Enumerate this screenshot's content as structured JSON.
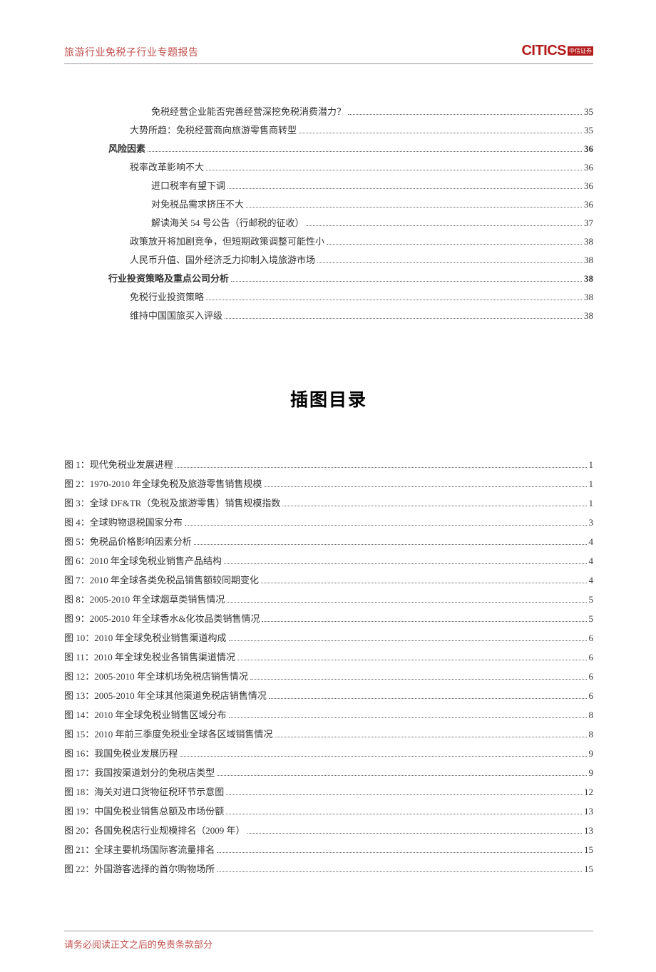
{
  "header": {
    "title": "旅游行业免税子行业专题报告",
    "logo_text": "CITICS",
    "logo_badge": "中信证券"
  },
  "toc": [
    {
      "level": 3,
      "label": "免税经营企业能否完善经营深挖免税消费潜力？",
      "page": "35",
      "bold": false
    },
    {
      "level": 2,
      "label": "大势所趋：免税经营商向旅游零售商转型",
      "page": "35",
      "bold": false
    },
    {
      "level": 1,
      "label": "风险因素",
      "page": "36",
      "bold": true
    },
    {
      "level": 2,
      "label": "税率改革影响不大",
      "page": "36",
      "bold": false
    },
    {
      "level": 3,
      "label": "进口税率有望下调",
      "page": "36",
      "bold": false
    },
    {
      "level": 3,
      "label": "对免税品需求挤压不大",
      "page": "36",
      "bold": false
    },
    {
      "level": 3,
      "label": "解读海关 54 号公告（行邮税的征收）",
      "page": "37",
      "bold": false
    },
    {
      "level": 2,
      "label": "政策放开将加剧竞争，但短期政策调整可能性小",
      "page": "38",
      "bold": false
    },
    {
      "level": 2,
      "label": "人民币升值、国外经济乏力抑制入境旅游市场",
      "page": "38",
      "bold": false
    },
    {
      "level": 1,
      "label": "行业投资策略及重点公司分析",
      "page": "38",
      "bold": true
    },
    {
      "level": 2,
      "label": "免税行业投资策略",
      "page": "38",
      "bold": false
    },
    {
      "level": 2,
      "label": "维持中国国旅买入评级",
      "page": "38",
      "bold": false
    }
  ],
  "figures_title": "插图目录",
  "figures": [
    {
      "label": "图 1：现代免税业发展进程",
      "page": "1"
    },
    {
      "label": "图 2：1970-2010 年全球免税及旅游零售销售规模",
      "page": "1"
    },
    {
      "label": "图 3：全球 DF&TR（免税及旅游零售）销售规模指数",
      "page": "1"
    },
    {
      "label": "图 4：全球购物退税国家分布",
      "page": "3"
    },
    {
      "label": "图 5：免税品价格影响因素分析",
      "page": "4"
    },
    {
      "label": "图 6：2010 年全球免税业销售产品结构",
      "page": "4"
    },
    {
      "label": "图 7：2010 年全球各类免税品销售额较同期变化",
      "page": "4"
    },
    {
      "label": "图 8：2005-2010 年全球烟草类销售情况",
      "page": "5"
    },
    {
      "label": "图 9：2005-2010 年全球香水&化妆品类销售情况",
      "page": "5"
    },
    {
      "label": "图 10：2010 年全球免税业销售渠道构成",
      "page": "6"
    },
    {
      "label": "图 11：2010 年全球免税业各销售渠道情况",
      "page": "6"
    },
    {
      "label": "图 12：2005-2010 年全球机场免税店销售情况",
      "page": "6"
    },
    {
      "label": "图 13：2005-2010 年全球其他渠道免税店销售情况",
      "page": "6"
    },
    {
      "label": "图 14：2010 年全球免税业销售区域分布",
      "page": "8"
    },
    {
      "label": "图 15：2010 年前三季度免税业全球各区域销售情况",
      "page": "8"
    },
    {
      "label": "图 16：我国免税业发展历程",
      "page": "9"
    },
    {
      "label": "图 17：我国按渠道划分的免税店类型",
      "page": "9"
    },
    {
      "label": "图 18：海关对进口货物征税环节示意图",
      "page": "12"
    },
    {
      "label": "图 19：中国免税业销售总额及市场份额",
      "page": "13"
    },
    {
      "label": "图 20：各国免税店行业规模排名（2009 年）",
      "page": "13"
    },
    {
      "label": "图 21：全球主要机场国际客流量排名",
      "page": "15"
    },
    {
      "label": "图 22：外国游客选择的首尔购物场所",
      "page": "15"
    }
  ],
  "footer": "请务必阅读正文之后的免责条款部分"
}
